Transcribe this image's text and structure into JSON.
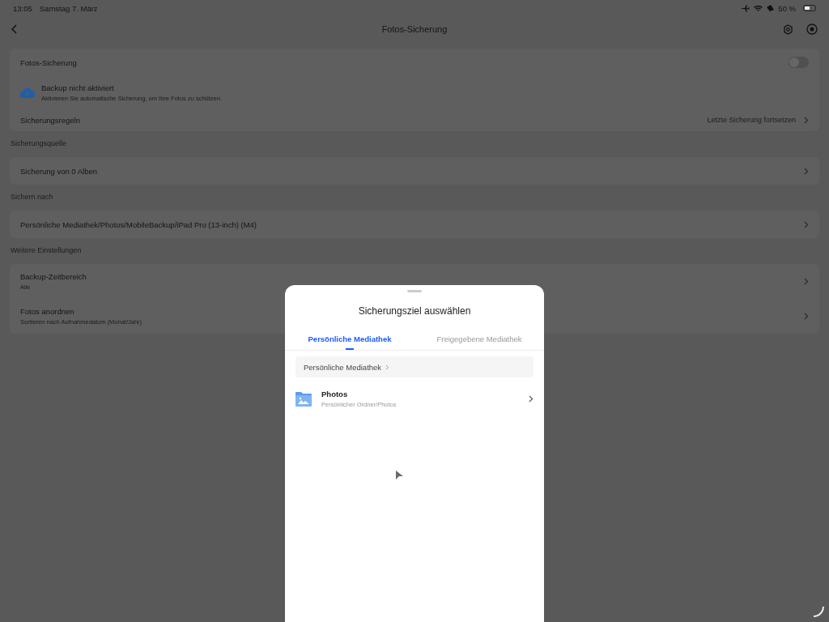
{
  "status_bar": {
    "time": "13:05",
    "date": "Samstag 7. März",
    "battery": "50 %"
  },
  "nav": {
    "title": "Fotos-Sicherung"
  },
  "backup_card": {
    "toggle_label": "Fotos-Sicherung",
    "toggle_on": false,
    "status_title": "Backup nicht aktiviert",
    "status_text": "Aktivieren Sie automatische Sicherung, um Ihre Fotos zu schützen.",
    "rules_label": "Sicherungsregeln",
    "rules_value": "Letzte Sicherung fortsetzen"
  },
  "sections": [
    {
      "header": "Sicherungsquelle",
      "rows": [
        {
          "title": "Sicherung von 0 Alben"
        }
      ]
    },
    {
      "header": "Sichern nach",
      "rows": [
        {
          "title": "Persönliche Mediathek/Photos/MobileBackup/iPad Pro (13-inch) (M4)"
        }
      ]
    },
    {
      "header": "Weitere Einstellungen",
      "rows": [
        {
          "title": "Backup-Zeitbereich",
          "subtitle": "Alle"
        },
        {
          "title": "Fotos anordnen",
          "subtitle": "Sortieren nach Aufnahmedatum (Monat/Jahr)"
        }
      ]
    }
  ],
  "sheet": {
    "title": "Sicherungsziel auswählen",
    "tabs": [
      {
        "label": "Persönliche Mediathek",
        "selected": true
      },
      {
        "label": "Freigegebene Mediathek",
        "selected": false
      }
    ],
    "breadcrumb": "Persönliche Mediathek",
    "folders": [
      {
        "name": "Photos",
        "path": "Persönlicher Ordner/Photos"
      }
    ]
  }
}
